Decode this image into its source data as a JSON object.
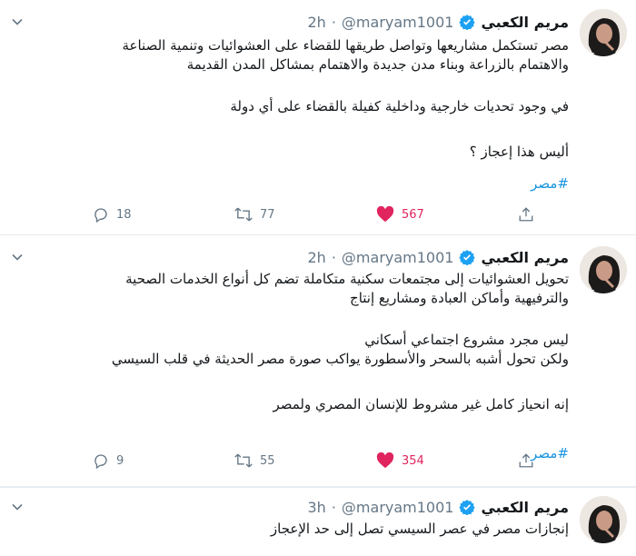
{
  "tweets": [
    {
      "name": "مريم الكعبي",
      "handle": "@maryam1001",
      "dot": "·",
      "time": "2h",
      "lines": [
        "مصر تستكمل مشاريعها وتواصل طريقها للقضاء على العشوائيات وتنمية الصناعة",
        "والاهتمام بالزراعة وبناء مدن جديدة والاهتمام بمشاكل المدن القديمة",
        "",
        "في وجود تحديات خارجية وداخلية كفيلة بالقضاء على أي دولة",
        "",
        "أليس هذا إعجاز ؟"
      ],
      "hashtag": "#مصر",
      "replies": "18",
      "retweets": "77",
      "likes": "567"
    },
    {
      "name": "مريم الكعبي",
      "handle": "@maryam1001",
      "dot": "·",
      "time": "2h",
      "lines": [
        "تحويل العشوائيات إلى مجتمعات سكنية متكاملة تضم كل أنواع الخدمات الصحية",
        "والترفيهية وأماكن العبادة ومشاريع إنتاج",
        "",
        "ليس مجرد مشروع اجتماعي أسكاني",
        "ولكن تحول أشبه بالسحر والأسطورة يواكب صورة مصر الحديثة في قلب السيسي",
        "",
        "إنه انحياز كامل غير مشروط للإنسان المصري ولمصر"
      ],
      "hashtag": "#مصر",
      "replies": "9",
      "retweets": "55",
      "likes": "354"
    },
    {
      "name": "مريم الكعبي",
      "handle": "@maryam1001",
      "dot": "·",
      "time": "3h",
      "lines": [
        "إنجازات مصر في عصر السيسي تصل إلى حد الإعجاز"
      ]
    }
  ],
  "icons": {
    "verified": "verified-badge-icon",
    "more": "chevron-down-icon",
    "reply": "reply-icon",
    "retweet": "retweet-icon",
    "like": "heart-icon",
    "share": "share-icon"
  },
  "colors": {
    "accent": "#1da1f2",
    "hashtag": "#1b95e0",
    "like": "#e0245e",
    "muted": "#657786"
  }
}
